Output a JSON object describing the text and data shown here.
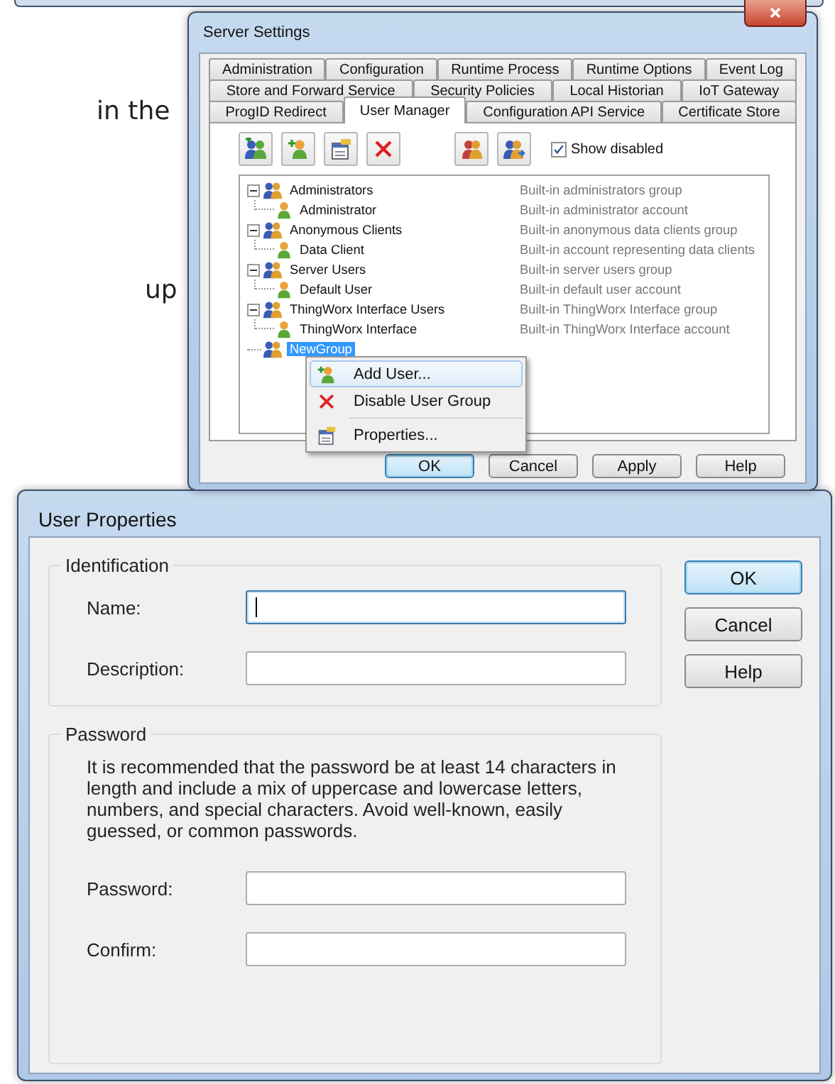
{
  "background_document": {
    "fragments": [
      "in the",
      "up"
    ]
  },
  "server_settings": {
    "title": "Server Settings",
    "tab_rows": [
      [
        {
          "label": "Administration",
          "selected": false
        },
        {
          "label": "Configuration",
          "selected": false
        },
        {
          "label": "Runtime Process",
          "selected": false
        },
        {
          "label": "Runtime Options",
          "selected": false
        },
        {
          "label": "Event Log",
          "selected": false
        }
      ],
      [
        {
          "label": "Store and Forward Service",
          "selected": false
        },
        {
          "label": "Security Policies",
          "selected": false
        },
        {
          "label": "Local Historian",
          "selected": false
        },
        {
          "label": "IoT Gateway",
          "selected": false
        }
      ],
      [
        {
          "label": "ProgID Redirect",
          "selected": false
        },
        {
          "label": "User Manager",
          "selected": true
        },
        {
          "label": "Configuration API Service",
          "selected": false
        },
        {
          "label": "Certificate Store",
          "selected": false
        }
      ]
    ],
    "toolbar": [
      {
        "kind": "add-group"
      },
      {
        "kind": "add-user"
      },
      {
        "kind": "properties"
      },
      {
        "kind": "delete"
      },
      {
        "kind": "import"
      },
      {
        "kind": "export"
      }
    ],
    "show_disabled": {
      "label": "Show disabled",
      "checked": true
    },
    "tree": [
      {
        "name": "Administrators",
        "description": "Built-in administrators group",
        "expanded": true,
        "selected": false,
        "children": [
          {
            "name": "Administrator",
            "description": "Built-in administrator account",
            "selected": false
          }
        ]
      },
      {
        "name": "Anonymous Clients",
        "description": "Built-in anonymous data clients group",
        "expanded": true,
        "selected": false,
        "children": [
          {
            "name": "Data Client",
            "description": "Built-in account representing data clients",
            "selected": false
          }
        ]
      },
      {
        "name": "Server Users",
        "description": "Built-in server users group",
        "expanded": true,
        "selected": false,
        "children": [
          {
            "name": "Default User",
            "description": "Built-in default user account",
            "selected": false
          }
        ]
      },
      {
        "name": "ThingWorx Interface Users",
        "description": "Built-in ThingWorx Interface group",
        "expanded": true,
        "selected": false,
        "children": [
          {
            "name": "ThingWorx Interface",
            "description": "Built-in ThingWorx Interface account",
            "selected": false
          }
        ]
      },
      {
        "name": "NewGroup",
        "selected": true
      }
    ],
    "context_menu": [
      {
        "label": "Add User...",
        "kind": "add-user",
        "highlighted": true,
        "separator_before": false
      },
      {
        "label": "Disable User Group",
        "kind": "delete",
        "highlighted": false,
        "separator_before": false
      },
      {
        "label": "Properties...",
        "kind": "properties",
        "highlighted": false,
        "separator_before": true
      }
    ],
    "buttons": [
      {
        "label": "OK",
        "default": true
      },
      {
        "label": "Cancel",
        "default": false
      },
      {
        "label": "Apply",
        "default": false
      },
      {
        "label": "Help",
        "default": false
      }
    ]
  },
  "user_properties": {
    "title": "User Properties",
    "identification": {
      "title": "Identification",
      "fields": [
        {
          "label": "Name:",
          "focused": true
        },
        {
          "label": "Description:",
          "focused": false
        }
      ]
    },
    "password": {
      "title": "Password",
      "note": "It is recommended that the password be at least 14 characters in length and include a mix of uppercase and lowercase letters, numbers, and special characters. Avoid well-known, easily guessed, or common passwords.",
      "fields": [
        {
          "label": "Password:",
          "focused": false
        },
        {
          "label": "Confirm:",
          "focused": false
        }
      ]
    },
    "buttons": [
      {
        "label": "OK",
        "default": true
      },
      {
        "label": "Cancel",
        "default": false
      },
      {
        "label": "Help",
        "default": false
      }
    ]
  }
}
